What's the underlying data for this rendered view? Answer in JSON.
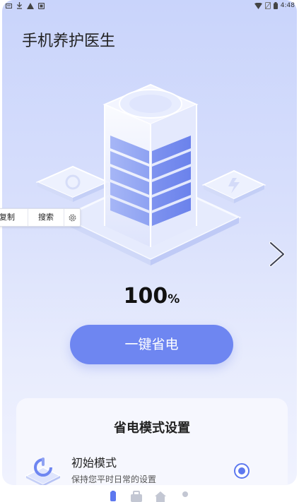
{
  "status_bar": {
    "time": "4:48",
    "icons": [
      "notification-icon",
      "download-icon",
      "warning-icon",
      "app-icon",
      "wifi-icon",
      "no-sim-icon",
      "battery-icon"
    ]
  },
  "app": {
    "title": "手机养护医生"
  },
  "battery": {
    "percent": "100",
    "unit": "%"
  },
  "primary_action": {
    "label": "一键省电"
  },
  "settings": {
    "title": "省电模式设置",
    "modes": [
      {
        "name": "初始模式",
        "description": "保持您平时日常的设置",
        "selected": true
      }
    ]
  },
  "text_toolbar": {
    "copy": "复制",
    "search": "搜索"
  },
  "bottom_nav": {
    "items": [
      "battery-tab-icon",
      "toolbox-tab-icon",
      "home-tab-icon",
      "profile-tab-icon"
    ]
  },
  "colors": {
    "accent": "#6e86f1",
    "radio": "#5d78ef",
    "card_top": "#c9d4fb",
    "card_bottom": "#f0f2fe"
  }
}
